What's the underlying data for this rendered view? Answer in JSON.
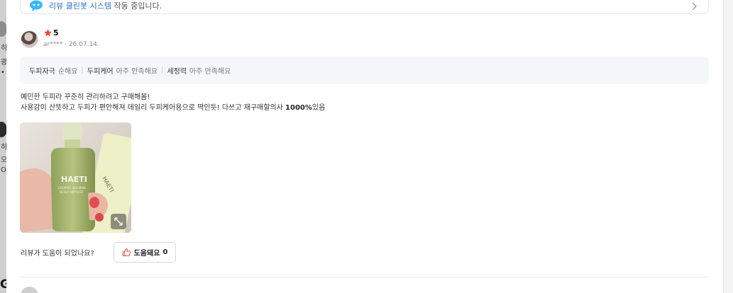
{
  "banner": {
    "highlight": "리뷰 클린봇 시스템",
    "text": "작동 중입니다."
  },
  "left_strip": {
    "fragments": [
      "히",
      "광",
      "•",
      "히",
      "오",
      "O",
      "G"
    ]
  },
  "review": {
    "rating": "5",
    "author": "ar****",
    "date": "26.07.14.",
    "attributes": [
      {
        "key": "두피자극",
        "value": "순해요"
      },
      {
        "key": "두피케어",
        "value": "아주 만족해요"
      },
      {
        "key": "세정력",
        "value": "아주 만족해요"
      }
    ],
    "body_line1": "예민한 두피라 꾸준히 관리하려고 구매해봄!",
    "body_line2_prefix": "사용감이 산뜻하고 두피가 편안해져 데일리 두피케어용으로 딱인듯! 다쓰고 재구매할의사 ",
    "body_line2_bold": "1000%",
    "body_line2_suffix": "있음",
    "photo_label_brand": "HAETI",
    "photo_label_line1": "CALMING SEA MINE",
    "photo_label_line2": "SCALP AMPOULE",
    "photo_label_box": "HAETI"
  },
  "helpful": {
    "question": "리뷰가 도움이 되었나요?",
    "button_label": "도움돼요",
    "count": "0"
  },
  "colors": {
    "star": "#f04a32",
    "link": "#2f6fd6",
    "attr_bg": "#f6f7fa",
    "thumb": "#e8442c"
  },
  "icons": [
    "chat-bot-icon",
    "chevron-right-icon",
    "star-icon",
    "expand-icon",
    "thumbs-up-icon"
  ]
}
